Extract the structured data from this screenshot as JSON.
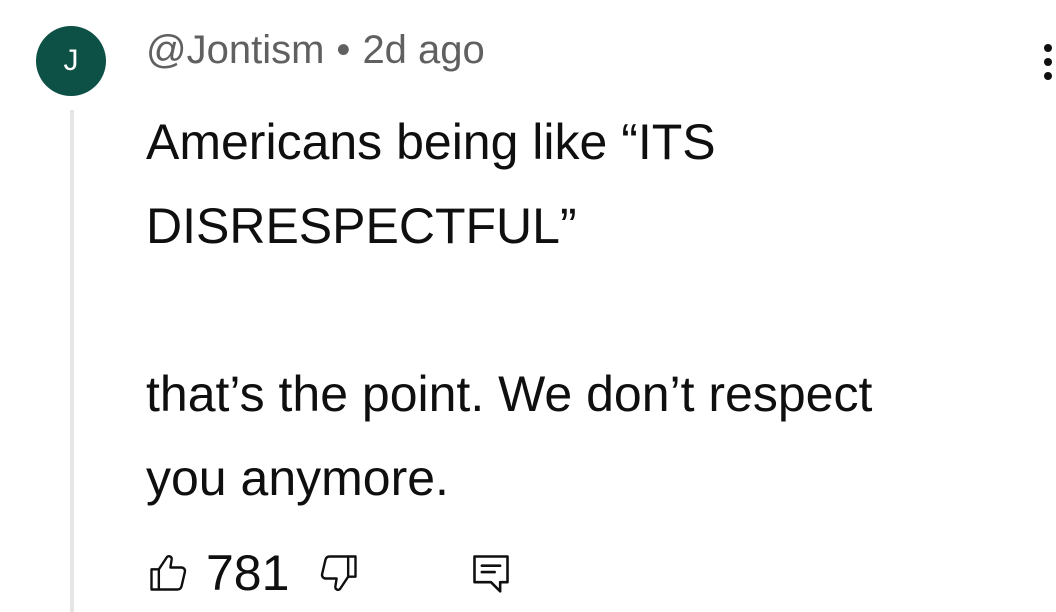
{
  "comment": {
    "avatar_letter": "J",
    "author": "@Jontism",
    "separator": "•",
    "timestamp": "2d ago",
    "text": "Americans being like “ITS\nDISRESPECTFUL”\n\nthat’s the point. We don’t respect\nyou anymore.",
    "like_count": "781"
  },
  "icons": {
    "avatar": "avatar-circle",
    "more": "vertical-ellipsis-icon",
    "like": "thumbs-up-icon",
    "dislike": "thumbs-down-icon",
    "reply": "comment-reply-icon"
  },
  "colors": {
    "avatar_bg": "#0d5146",
    "meta_text": "#606060",
    "body_text": "#0f0f0f",
    "thread_line": "#e5e5e5"
  }
}
